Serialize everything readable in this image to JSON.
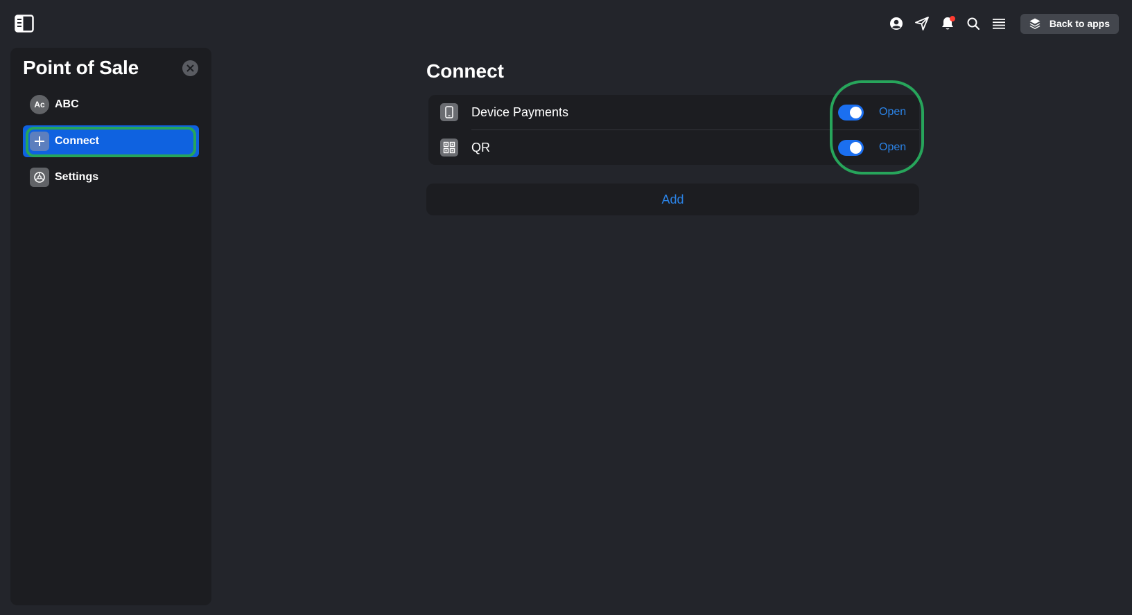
{
  "topbar": {
    "sidebar_toggle_icon": "sidebar-toggle-icon",
    "icons": [
      "account-icon",
      "send-icon",
      "bell-icon",
      "search-icon",
      "menu-icon"
    ],
    "back_button_label": "Back to apps",
    "back_button_icon": "layers-icon"
  },
  "sidebar": {
    "title": "Point of Sale",
    "items": [
      {
        "label": "ABC",
        "avatar": "Ac",
        "active": false
      },
      {
        "label": "Connect",
        "icon": "plus-icon",
        "active": true
      },
      {
        "label": "Settings",
        "icon": "settings-icon",
        "active": false
      }
    ]
  },
  "main": {
    "title": "Connect",
    "connections": [
      {
        "label": "Device Payments",
        "icon": "phone-icon",
        "enabled": true,
        "action": "Open"
      },
      {
        "label": "QR",
        "icon": "qr-icon",
        "enabled": true,
        "action": "Open"
      }
    ],
    "add_label": "Add"
  },
  "colors": {
    "background": "#23252b",
    "panel": "#1c1d21",
    "accent": "#0f62e0",
    "link": "#2b83e6",
    "highlight": "#27a55b",
    "notification": "#ff3b30"
  }
}
